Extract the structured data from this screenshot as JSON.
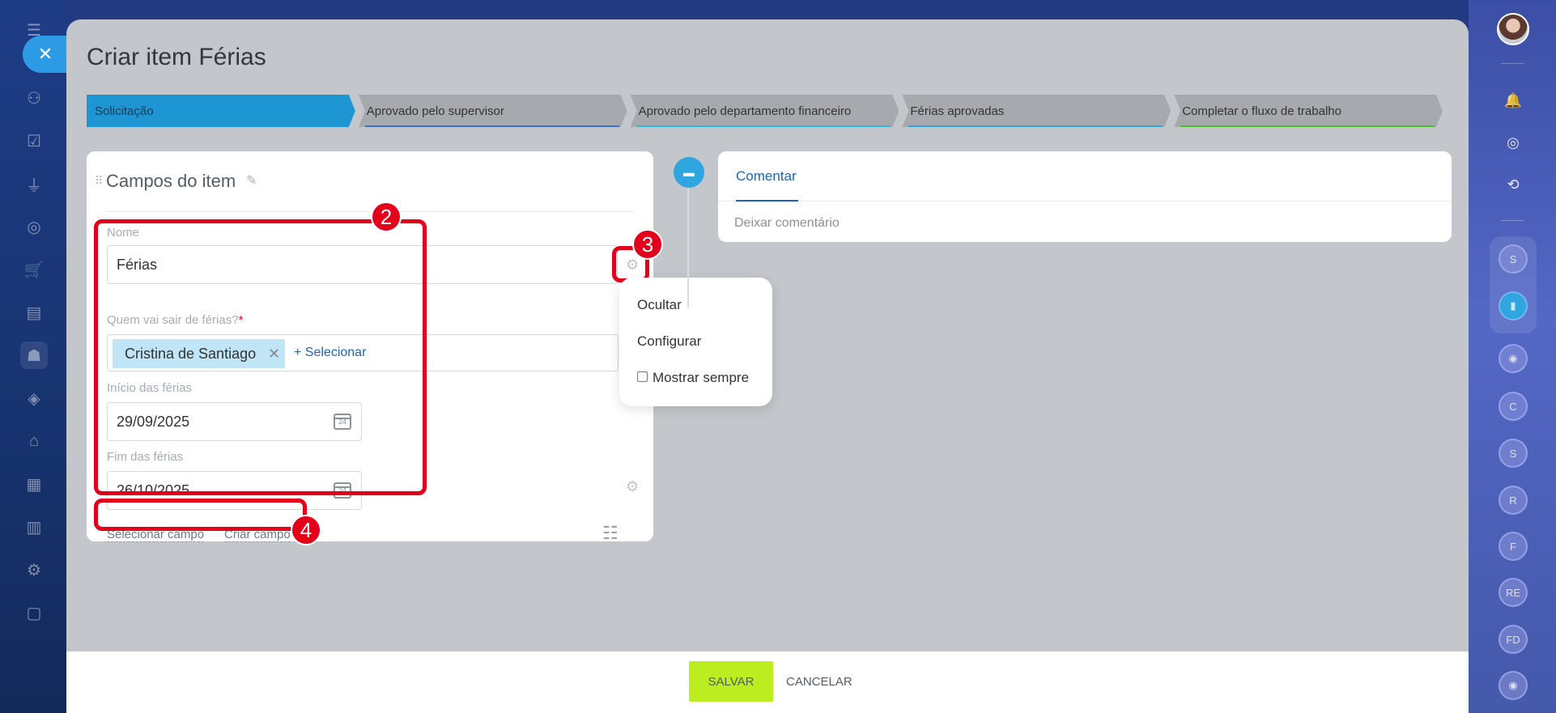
{
  "page": {
    "title": "Criar item Férias"
  },
  "stages": [
    {
      "label": "Solicitação",
      "color": "#1f96d4"
    },
    {
      "label": "Aprovado pelo supervisor",
      "color": "#3b6fd4"
    },
    {
      "label": "Aprovado pelo departamento financeiro",
      "color": "#2fb6d8"
    },
    {
      "label": "Férias aprovadas",
      "color": "#2fa6df"
    },
    {
      "label": "Completar o fluxo de trabalho",
      "color": "#4ac028"
    }
  ],
  "fields_card": {
    "title": "Campos do item",
    "name_label": "Nome",
    "name_value": "Férias",
    "who_label": "Quem vai sair de férias?",
    "who_required": "*",
    "who_tag": "Cristina de Santiago",
    "select_link": "+ Selecionar",
    "start_label": "Início das férias",
    "start_value": "29/09/2025",
    "end_label": "Fim das férias",
    "end_value": "26/10/2025",
    "calendar_day": "24",
    "select_field": "Selecionar campo",
    "create_field": "Criar campo"
  },
  "popup": {
    "hide": "Ocultar",
    "configure": "Configurar",
    "always_show": "Mostrar sempre"
  },
  "comment": {
    "tab": "Comentar",
    "placeholder": "Deixar comentário"
  },
  "annotations": {
    "n2": "2",
    "n3": "3",
    "n4": "4"
  },
  "right_bar": {
    "circles": [
      "S",
      "C",
      "S",
      "R",
      "F",
      "RE",
      "FD"
    ]
  },
  "footer": {
    "save": "SALVAR",
    "cancel": "CANCELAR"
  },
  "colors": {
    "accent": "#1f96d4",
    "save_button": "#bbed21",
    "annotation": "#e3001b"
  }
}
